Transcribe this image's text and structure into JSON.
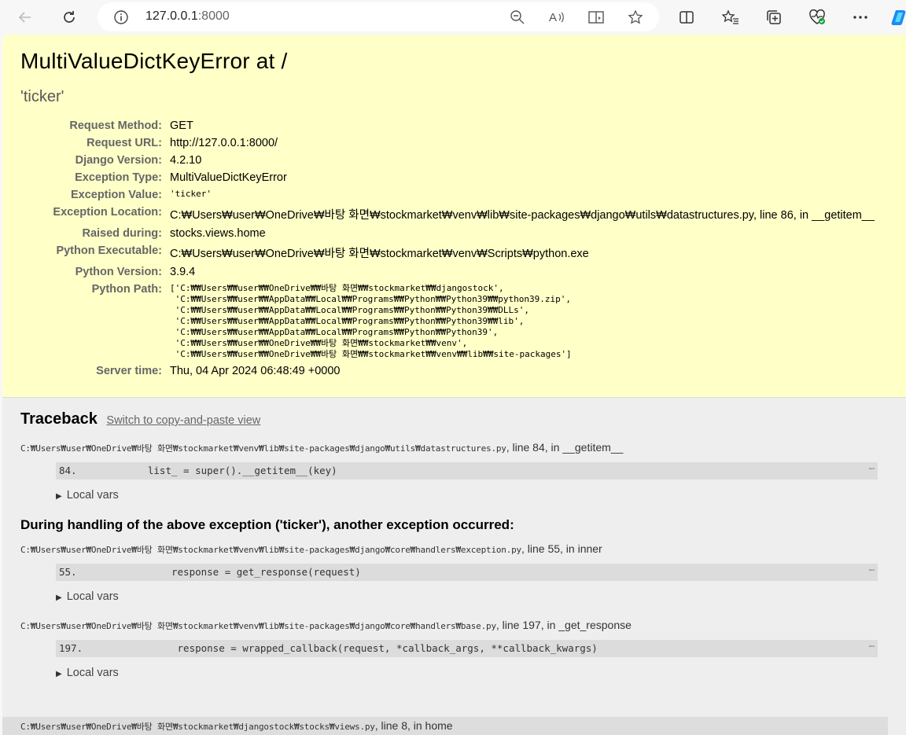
{
  "browser": {
    "url_host": "127.0.0.1",
    "url_port": ":8000"
  },
  "error": {
    "title": "MultiValueDictKeyError at /",
    "value": "'ticker'",
    "meta": [
      {
        "label": "Request Method:",
        "value": "GET"
      },
      {
        "label": "Request URL:",
        "value": "http://127.0.0.1:8000/"
      },
      {
        "label": "Django Version:",
        "value": "4.2.10"
      },
      {
        "label": "Exception Type:",
        "value": "MultiValueDictKeyError"
      },
      {
        "label": "Exception Value:",
        "value": "'ticker'"
      },
      {
        "label": "Exception Location:",
        "value": "C:₩Users₩user₩OneDrive₩바탕 화면₩stockmarket₩venv₩lib₩site-packages₩django₩utils₩datastructures.py, line 86, in __getitem__"
      },
      {
        "label": "Raised during:",
        "value": "stocks.views.home"
      },
      {
        "label": "Python Executable:",
        "value": "C:₩Users₩user₩OneDrive₩바탕 화면₩stockmarket₩venv₩Scripts₩python.exe"
      },
      {
        "label": "Python Version:",
        "value": "3.9.4"
      },
      {
        "label": "Python Path:",
        "value": "['C:₩₩Users₩₩user₩₩OneDrive₩₩바탕 화면₩₩stockmarket₩₩djangostock',\n 'C:₩₩Users₩₩user₩₩AppData₩₩Local₩₩Programs₩₩Python₩₩Python39₩₩python39.zip',\n 'C:₩₩Users₩₩user₩₩AppData₩₩Local₩₩Programs₩₩Python₩₩Python39₩₩DLLs',\n 'C:₩₩Users₩₩user₩₩AppData₩₩Local₩₩Programs₩₩Python₩₩Python39₩₩lib',\n 'C:₩₩Users₩₩user₩₩AppData₩₩Local₩₩Programs₩₩Python₩₩Python39',\n 'C:₩₩Users₩₩user₩₩OneDrive₩₩바탕 화면₩₩stockmarket₩₩venv',\n 'C:₩₩Users₩₩user₩₩OneDrive₩₩바탕 화면₩₩stockmarket₩₩venv₩₩lib₩₩site-packages']"
      },
      {
        "label": "Server time:",
        "value": "Thu, 04 Apr 2024 06:48:49 +0000"
      }
    ]
  },
  "traceback": {
    "heading": "Traceback",
    "switch_link": "Switch to copy-and-paste view",
    "during": "During handling of the above exception ('ticker'), another exception occurred:",
    "local_vars": "Local vars",
    "frames": [
      {
        "file": "C:₩Users₩user₩OneDrive₩바탕 화면₩stockmarket₩venv₩lib₩site-packages₩django₩utils₩datastructures.py",
        "where": ", line 84, in __getitem__",
        "code": "84.            list_ = super().__getitem__(key)"
      },
      {
        "file": "C:₩Users₩user₩OneDrive₩바탕 화면₩stockmarket₩venv₩lib₩site-packages₩django₩core₩handlers₩exception.py",
        "where": ", line 55, in inner",
        "code": "55.                response = get_response(request)"
      },
      {
        "file": "C:₩Users₩user₩OneDrive₩바탕 화면₩stockmarket₩venv₩lib₩site-packages₩django₩core₩handlers₩base.py",
        "where": ", line 197, in _get_response",
        "code": "197.                response = wrapped_callback(request, *callback_args, **callback_kwargs)"
      },
      {
        "file": "C:₩Users₩user₩OneDrive₩바탕 화면₩stockmarket₩djangostock₩stocks₩views.py",
        "where": ", line 8, in home"
      }
    ],
    "more_glyph": "⋯"
  }
}
